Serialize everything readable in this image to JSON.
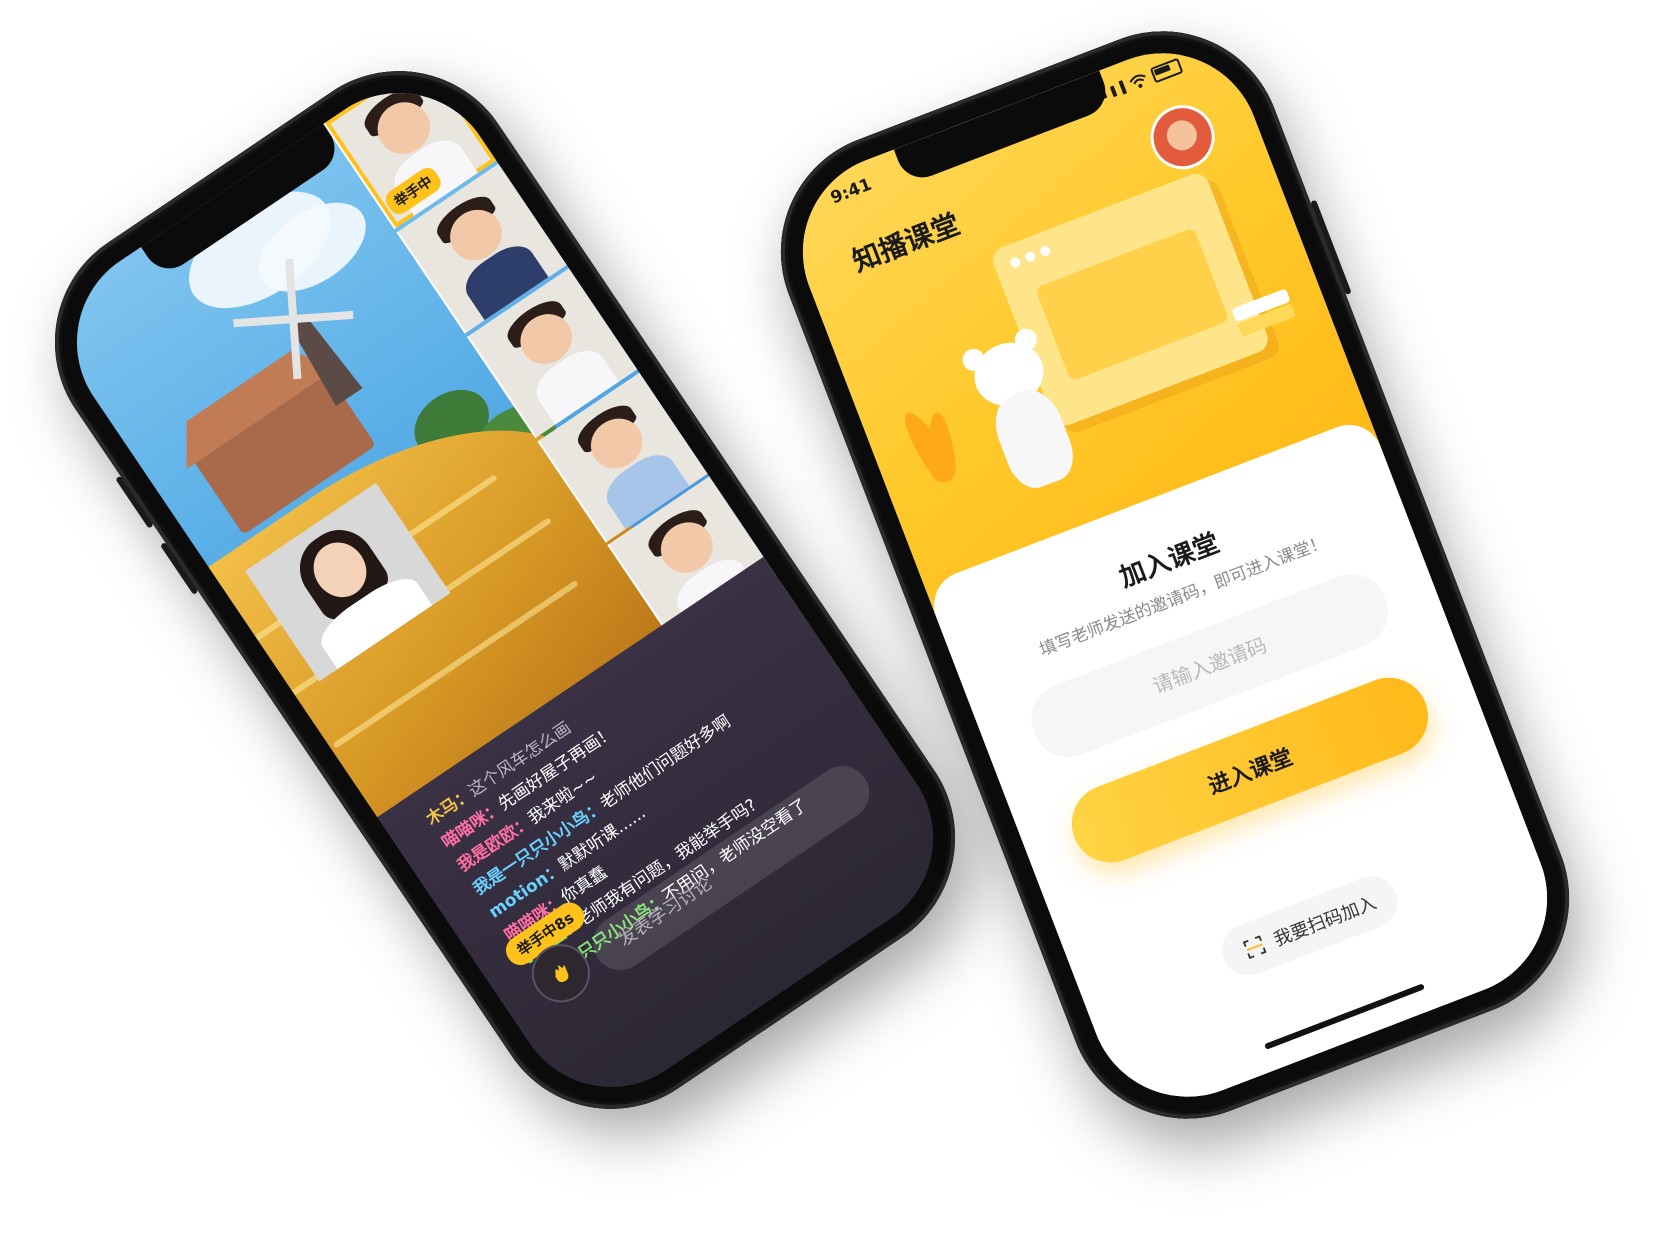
{
  "left_phone": {
    "camera_raise_tag": "举手中",
    "chat_messages": [
      {
        "name": "木马：",
        "text": "这个风车怎么画",
        "name_color": "#f4c24a",
        "text_color": "#bdb6c4"
      },
      {
        "name": "喵喵咪：",
        "text": "先画好屋子再画！",
        "name_color": "#ff6fa3",
        "text_color": "#ffffff"
      },
      {
        "name": "我是欧欧：",
        "text": "我来啦~~",
        "name_color": "#ff6fa3",
        "text_color": "#ffffff"
      },
      {
        "name": "我是一只只小小鸟：",
        "text": "老师他们问题好多啊",
        "name_color": "#6ad1ff",
        "text_color": "#ffffff"
      },
      {
        "name": "motion：",
        "text": "默默听课......",
        "name_color": "#6ad1ff",
        "text_color": "#ffffff"
      },
      {
        "name": "喵喵咪：",
        "text": "你真蠢",
        "name_color": "#ff6fa3",
        "text_color": "#ffffff"
      },
      {
        "name": "小学生：",
        "text": "老师我有问题，我能举手吗?",
        "name_color": "#7ee06b",
        "text_color": "#ffffff"
      },
      {
        "name": "我是一只只小小鸟：",
        "text": "不用问，老师没空看了",
        "name_color": "#7ee06b",
        "text_color": "#ffffff"
      }
    ],
    "raise_hand_badge": "举手中8s",
    "chat_input_placeholder": "发表学习讨论"
  },
  "right_phone": {
    "status_time": "9:41",
    "app_title": "知播课堂",
    "card_title": "加入课堂",
    "card_subtitle": "填写老师发送的邀请码，即可进入课堂！",
    "invite_placeholder": "请输入邀请码",
    "enter_button": "进入课堂",
    "scan_button": "我要扫码加入"
  },
  "colors": {
    "accent_yellow": "#ffc21a",
    "hero_yellow": "#ffc92b",
    "chat_bg": "#2c2734"
  }
}
